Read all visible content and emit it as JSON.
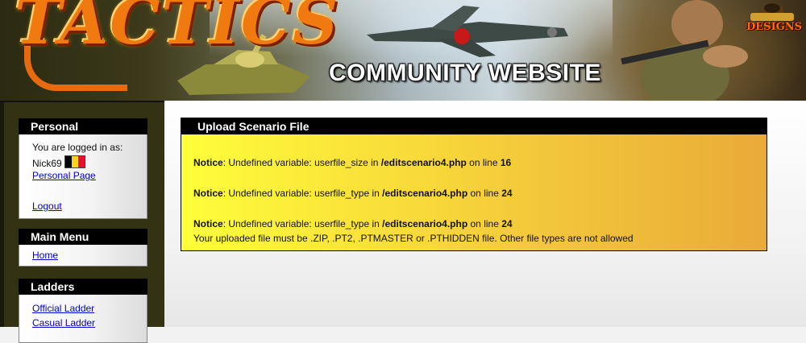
{
  "banner": {
    "logo_text": "TACTICS",
    "title": "COMMUNITY WEBSITE",
    "designs_label": "DESIGNS"
  },
  "sidebar": {
    "personal": {
      "title": "Personal",
      "logged_in_text": "You are logged in as:",
      "username": "Nick69",
      "flag_icon": "belgium-flag-icon",
      "personal_page_link": "Personal Page",
      "logout_link": "Logout"
    },
    "main_menu": {
      "title": "Main Menu",
      "items": [
        "Home"
      ]
    },
    "ladders": {
      "title": "Ladders",
      "items": [
        "Official Ladder",
        "Casual Ladder"
      ]
    }
  },
  "main": {
    "panel_title": "Upload Scenario File",
    "notices": [
      {
        "label": "Notice",
        "text": ": Undefined variable: userfile_size in ",
        "file": "/editscenario4.php",
        "line_text": " on line ",
        "line": "16"
      },
      {
        "label": "Notice",
        "text": ": Undefined variable: userfile_type in ",
        "file": "/editscenario4.php",
        "line_text": " on line ",
        "line": "24"
      },
      {
        "label": "Notice",
        "text": ": Undefined variable: userfile_type in ",
        "file": "/editscenario4.php",
        "line_text": " on line ",
        "line": "24"
      }
    ],
    "upload_message": "Your uploaded file must be .ZIP, .PT2, .PTMASTER or .PTHIDDEN file. Other file types are not allowed"
  },
  "colors": {
    "sidebar_bg": "#333313",
    "box_header_bg": "#000000",
    "link": "#0000cc",
    "panel_gradient_start": "#fefe3a",
    "panel_gradient_end": "#e9ab38",
    "logo_orange": "#f07a10"
  }
}
